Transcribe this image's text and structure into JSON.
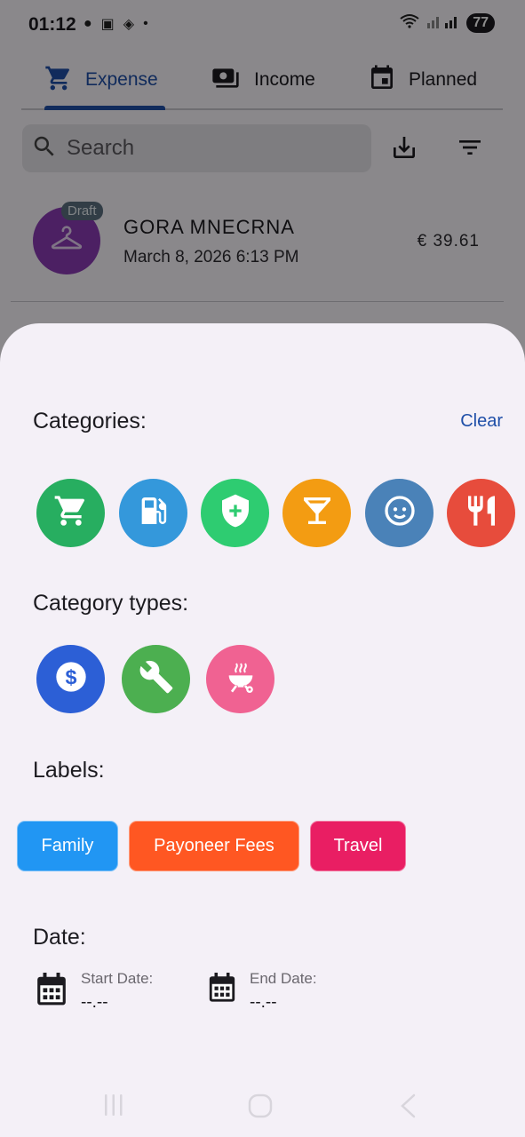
{
  "status_bar": {
    "time": "01:12",
    "battery": "77"
  },
  "tabs": [
    {
      "label": "Expense",
      "active": true,
      "icon": "cart-icon"
    },
    {
      "label": "Income",
      "active": false,
      "icon": "cash-icon"
    },
    {
      "label": "Planned",
      "active": false,
      "icon": "calendar-event-icon"
    }
  ],
  "search": {
    "placeholder": "Search"
  },
  "transaction": {
    "badge": "Draft",
    "title": "GORA MNECRNA",
    "date": "March 8, 2026 6:13 PM",
    "amount": "€ 39.61",
    "icon": "hanger-icon",
    "icon_color": "#8a3bb5"
  },
  "filter_sheet": {
    "categories_title": "Categories:",
    "clear_label": "Clear",
    "categories": [
      {
        "icon": "cart-icon",
        "color": "#27ae60"
      },
      {
        "icon": "fuel-icon",
        "color": "#3498db"
      },
      {
        "icon": "health-shield-icon",
        "color": "#2ecc71"
      },
      {
        "icon": "cocktail-icon",
        "color": "#f39c12"
      },
      {
        "icon": "baby-face-icon",
        "color": "#4a82b8"
      },
      {
        "icon": "restaurant-icon",
        "color": "#e74c3c"
      }
    ],
    "category_types_title": "Category types:",
    "category_types": [
      {
        "icon": "dollar-icon",
        "color": "#2c5fd6"
      },
      {
        "icon": "wrench-icon",
        "color": "#4caf50"
      },
      {
        "icon": "grill-icon",
        "color": "#f06292"
      }
    ],
    "labels_title": "Labels:",
    "labels": [
      {
        "text": "Family",
        "color": "#2196f3"
      },
      {
        "text": "Payoneer Fees",
        "color": "#ff5722"
      },
      {
        "text": "Travel",
        "color": "#e91e63"
      }
    ],
    "date_title": "Date:",
    "start_date_label": "Start Date:",
    "start_date_value": "--.--",
    "end_date_label": "End Date:",
    "end_date_value": "--.--"
  }
}
